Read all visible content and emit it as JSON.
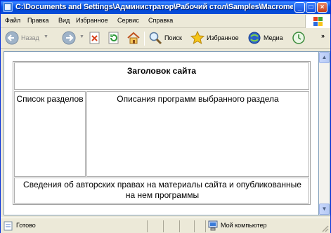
{
  "window": {
    "title": "C:\\Documents and Settings\\Администратор\\Рабочий стол\\Samples\\Macromedi..."
  },
  "menu": [
    {
      "label": "Файл"
    },
    {
      "label": "Правка"
    },
    {
      "label": "Вид"
    },
    {
      "label": "Избранное"
    },
    {
      "label": "Сервис"
    },
    {
      "label": "Справка"
    }
  ],
  "toolbar": {
    "back_label": "Назад",
    "search_label": "Поиск",
    "favorites_label": "Избранное",
    "media_label": "Медиа",
    "overflow_label": "»"
  },
  "page": {
    "header": "Заголовок сайта",
    "nav": "Список разделов",
    "main": "Описания программ выбранного раздела",
    "footer": "Сведения об авторских правах на материалы сайта и опубликованные на нем программы"
  },
  "status": {
    "left": "Готово",
    "zone": "Мой компьютер"
  },
  "colors": {
    "titlebar": "#0454e6",
    "chrome": "#ece9d8",
    "content": "#ffffff"
  }
}
